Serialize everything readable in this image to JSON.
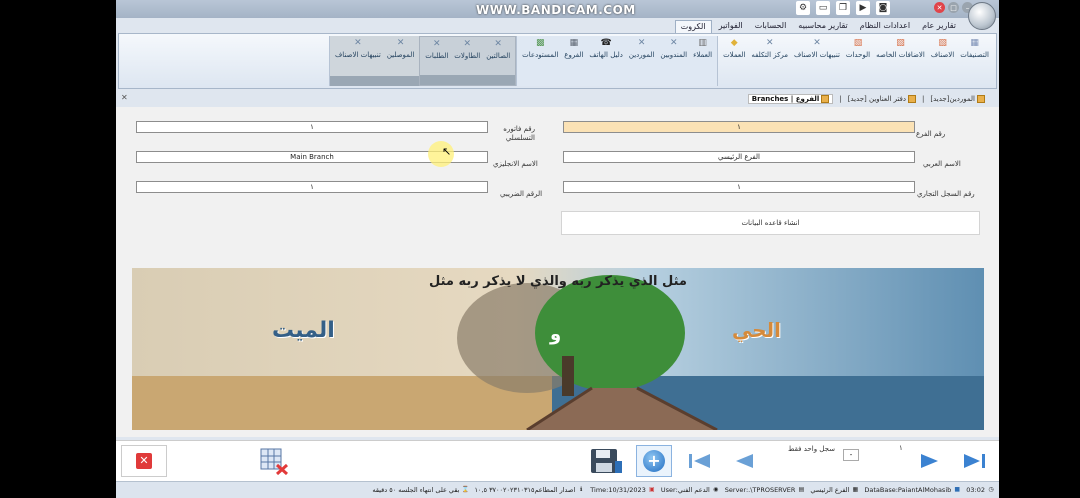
{
  "watermark": "WWW.BANDICAM.COM",
  "ribbon_tabs": [
    "الكروت",
    "الفواتير",
    "الحسابات",
    "تقارير محاسبيه",
    "اعدادات النظام",
    "تقارير عام"
  ],
  "ribbon_groups": [
    {
      "items": [
        {
          "label": "التصنيفات",
          "icon": "grid-icon",
          "color": "#7b8fb5"
        },
        {
          "label": "الاصناف",
          "icon": "boxes-icon",
          "color": "#d9724a"
        },
        {
          "label": "الاضافات الخاصه",
          "icon": "boxes-icon",
          "color": "#d9724a"
        },
        {
          "label": "الوحدات",
          "icon": "boxes-icon",
          "color": "#d9724a"
        },
        {
          "label": "تنبيهات الاصناف",
          "icon": "x-icon",
          "color": "#6d86a3"
        },
        {
          "label": "مركز التكلفه",
          "icon": "x-icon",
          "color": "#6d86a3"
        },
        {
          "label": "العملات",
          "icon": "coins-icon",
          "color": "#e0b23a"
        }
      ]
    },
    {
      "items": [
        {
          "label": "العملاء",
          "icon": "building-icon",
          "color": "#6f6f6f"
        },
        {
          "label": "المندوبين",
          "icon": "x-icon",
          "color": "#6d86a3"
        },
        {
          "label": "الموردين",
          "icon": "x-icon",
          "color": "#6d86a3"
        },
        {
          "label": "دليل الهاتف",
          "icon": "phone-icon",
          "color": "#222"
        },
        {
          "label": "الفروع",
          "icon": "branch-icon",
          "color": "#5b6470"
        },
        {
          "label": "المستودعات",
          "icon": "warehouse-icon",
          "color": "#5a9a5a"
        }
      ]
    },
    {
      "items": [
        {
          "label": "الصالتين",
          "icon": "x-icon",
          "color": "#6d86a3"
        },
        {
          "label": "الطاولات",
          "icon": "x-icon",
          "color": "#6d86a3"
        },
        {
          "label": "الطلبات",
          "icon": "x-icon",
          "color": "#6d86a3"
        }
      ]
    },
    {
      "items": [
        {
          "label": "الموصلين",
          "icon": "x-icon",
          "color": "#6d86a3"
        },
        {
          "label": "تنبيهات الاصناف",
          "icon": "x-icon",
          "color": "#6d86a3"
        }
      ]
    }
  ],
  "doc_tabs": [
    {
      "label": "الموردين[جديد]",
      "active": false
    },
    {
      "label": "دفتر العناوين [جديد]",
      "active": false
    },
    {
      "label": "الفروع | Branches",
      "active": true
    }
  ],
  "form": {
    "branch_no_label": "رقم الفرع",
    "branch_no_value": "١",
    "invoice_serial_label": "رقم فاتوره التسلسلي",
    "invoice_serial_value": "١",
    "arabic_name_label": "الاسم العربي",
    "arabic_name_value": "الفرع الرئيسي",
    "english_name_label": "الاسم الانجليزي",
    "english_name_value": "Main Branch",
    "cr_no_label": "رقم السجل التجاري",
    "cr_no_value": "١",
    "tax_no_label": "الرقم الضريبي",
    "tax_no_value": "١",
    "create_db_label": "انشاء قاعده البيانات"
  },
  "banner": {
    "line": "مثل الذي يذكر ربه والذي لا يذكر ربه مثل",
    "alive": "الحي",
    "and": "و",
    "dead": "الميت"
  },
  "nav": {
    "record_count": "سجل واحد فقط",
    "combo_value": "-",
    "record_number": "١"
  },
  "status": {
    "time": "03:02",
    "database": "DataBase:PaiantAlMohasib",
    "branch": "الفرع الرئيسي",
    "server": "Server:.\\TPROSERVER",
    "support": "الدعم الفني:User",
    "date": "Time:10/31/2023",
    "version": "اصدار المطاعم٣٧٠٠٢٠٢٣١٠٣١٥ ١٠,٥",
    "session": "بقي على انتهاء الجلسه ٥٠ دقيقه"
  }
}
